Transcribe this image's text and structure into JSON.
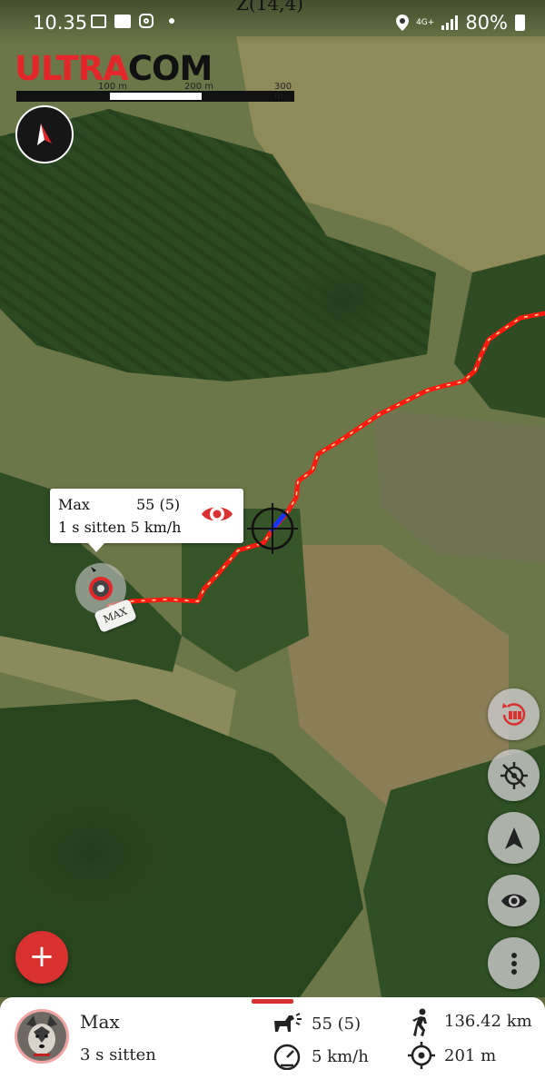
{
  "status_bar": {
    "time": "10.35",
    "zoom_label": "Z(14,4)",
    "network": "4G+",
    "battery": "80%"
  },
  "logo": {
    "part1": "ULTRA",
    "part2": "COM"
  },
  "scale": {
    "labels": [
      "100 m",
      "200 m",
      "300 m"
    ]
  },
  "popup": {
    "name": "Max",
    "count": "55 (5)",
    "status": "1 s sitten 5 km/h"
  },
  "dog_tag": "MAX",
  "side_buttons": [
    {
      "icon": "track-history-icon"
    },
    {
      "icon": "location-off-icon"
    },
    {
      "icon": "navigation-arrow-icon"
    },
    {
      "icon": "eye-icon"
    },
    {
      "icon": "more-vertical-icon"
    }
  ],
  "add_button": "+",
  "bottom_panel": {
    "name": "Max",
    "status": "3 s sitten",
    "bark_count": "55 (5)",
    "speed": "5 km/h",
    "distance_total": "136.42 km",
    "distance_to": "201 m"
  },
  "colors": {
    "accent": "#d8312f",
    "track": "#ff2a1a"
  }
}
